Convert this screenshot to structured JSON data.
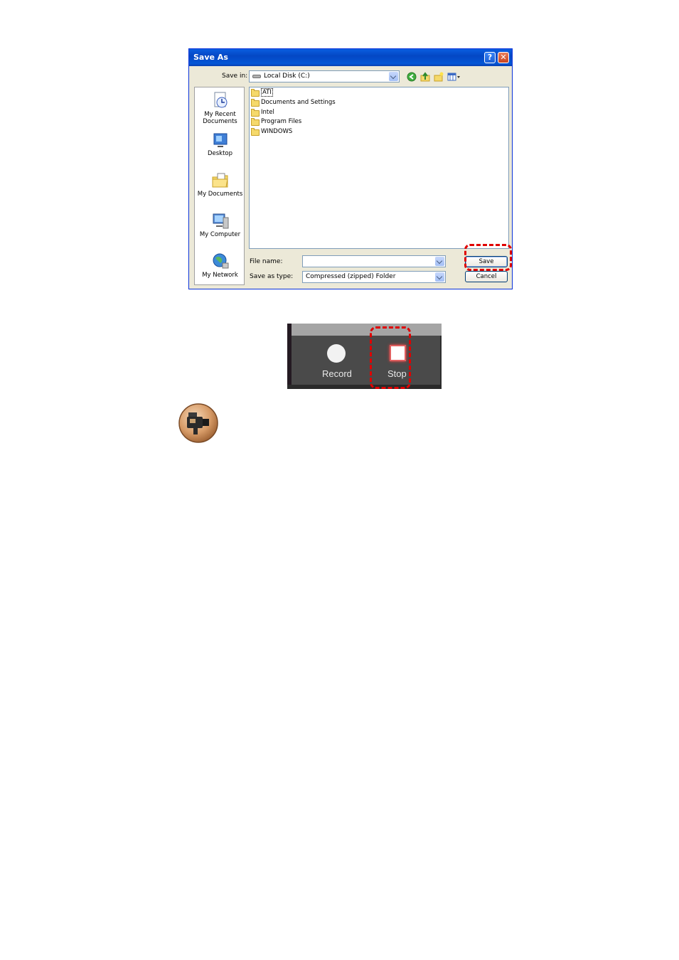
{
  "dialog": {
    "title": "Save As",
    "help_glyph": "?",
    "close_glyph": "✕",
    "save_in_label": "Save in:",
    "save_in_value": "Local Disk (C:)",
    "toolbar_icons": [
      "back-icon",
      "up-folder-icon",
      "new-folder-icon",
      "views-menu-icon"
    ],
    "places": [
      {
        "label_line1": "My Recent",
        "label_line2": "Documents",
        "icon": "recent-documents-icon"
      },
      {
        "label_line1": "Desktop",
        "label_line2": "",
        "icon": "desktop-icon"
      },
      {
        "label_line1": "My Documents",
        "label_line2": "",
        "icon": "my-documents-icon"
      },
      {
        "label_line1": "My Computer",
        "label_line2": "",
        "icon": "my-computer-icon"
      },
      {
        "label_line1": "My Network",
        "label_line2": "",
        "icon": "my-network-icon"
      }
    ],
    "files": [
      "ATI",
      "Documents and Settings",
      "Intel",
      "Program Files",
      "WINDOWS"
    ],
    "file_name_label": "File name:",
    "file_name_value": "",
    "save_type_label": "Save as type:",
    "save_type_value": "Compressed (zipped) Folder",
    "save_button": "Save",
    "cancel_button": "Cancel"
  },
  "recorder": {
    "record_label": "Record",
    "stop_label": "Stop"
  },
  "colors": {
    "highlight": "#e00000",
    "titlebar": "#0a5ee0",
    "dialog_bg": "#ece9d8"
  }
}
